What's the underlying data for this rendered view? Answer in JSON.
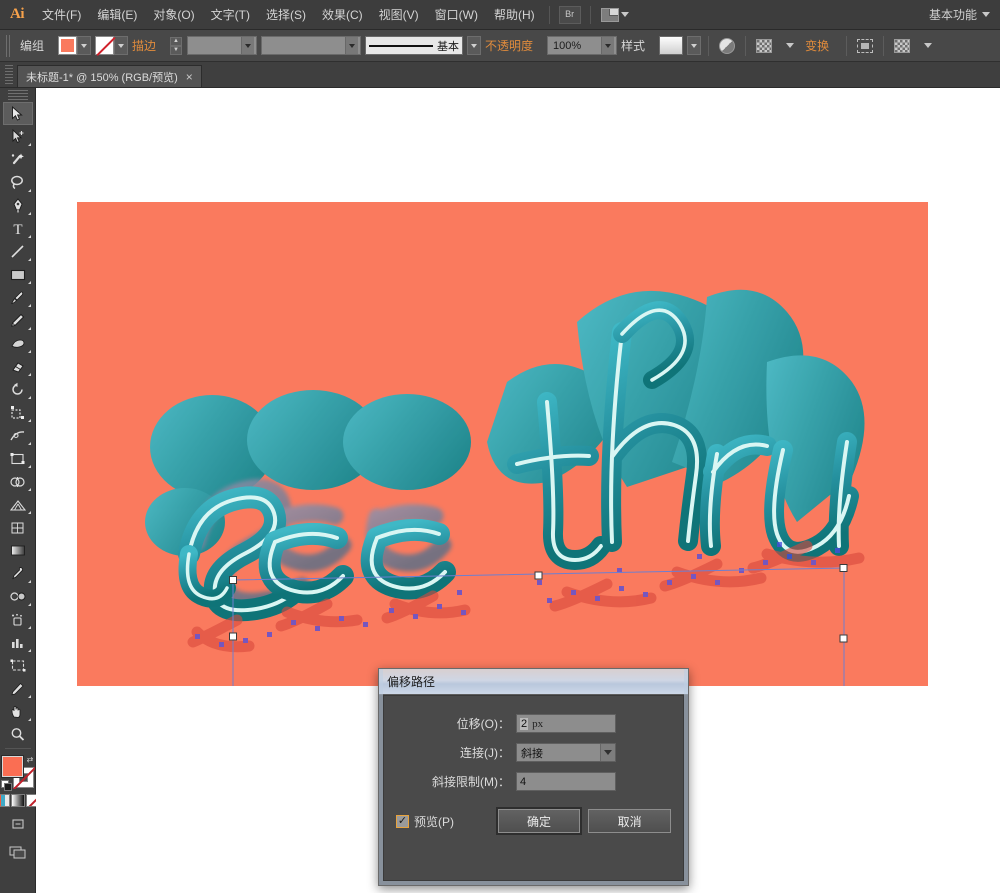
{
  "app": {
    "logo": "Ai",
    "workspace": "基本功能"
  },
  "menu": {
    "items": [
      {
        "label": "文件(F)"
      },
      {
        "label": "编辑(E)"
      },
      {
        "label": "对象(O)"
      },
      {
        "label": "文字(T)"
      },
      {
        "label": "选择(S)"
      },
      {
        "label": "效果(C)"
      },
      {
        "label": "视图(V)"
      },
      {
        "label": "窗口(W)"
      },
      {
        "label": "帮助(H)"
      }
    ],
    "bridge_icon": "bridge-icon",
    "arrange_icon": "arrange-documents-icon"
  },
  "controlbar": {
    "selection_label": "编组",
    "fill_color": "#fa7a5e",
    "stroke_label": "描边",
    "stroke_weight": "",
    "stroke_profile": "",
    "brush_label": "基本",
    "opacity_label": "不透明度",
    "opacity_value": "100%",
    "style_label": "样式",
    "transform_label": "变换",
    "icons": [
      "opacity-circle-icon",
      "recolor-icon",
      "align-icon",
      "shape-options-icon"
    ]
  },
  "document": {
    "tab_title": "未标题-1* @ 150% (RGB/预览)",
    "close_label": "×"
  },
  "toolbar": {
    "tools": [
      {
        "name": "selection-tool",
        "active": true
      },
      {
        "name": "direct-selection-tool",
        "active": false
      },
      {
        "name": "magic-wand-tool",
        "active": false
      },
      {
        "name": "lasso-tool",
        "active": false
      },
      {
        "name": "pen-tool",
        "active": false
      },
      {
        "name": "type-tool",
        "active": false
      },
      {
        "name": "line-segment-tool",
        "active": false
      },
      {
        "name": "rectangle-tool",
        "active": false
      },
      {
        "name": "paintbrush-tool",
        "active": false
      },
      {
        "name": "pencil-tool",
        "active": false
      },
      {
        "name": "blob-brush-tool",
        "active": false
      },
      {
        "name": "eraser-tool",
        "active": false
      },
      {
        "name": "rotate-tool",
        "active": false
      },
      {
        "name": "scale-tool",
        "active": false
      },
      {
        "name": "width-tool",
        "active": false
      },
      {
        "name": "free-transform-tool",
        "active": false
      },
      {
        "name": "shape-builder-tool",
        "active": false
      },
      {
        "name": "perspective-grid-tool",
        "active": false
      },
      {
        "name": "mesh-tool",
        "active": false
      },
      {
        "name": "gradient-tool",
        "active": false
      },
      {
        "name": "eyedropper-tool",
        "active": false
      },
      {
        "name": "blend-tool",
        "active": false
      },
      {
        "name": "symbol-sprayer-tool",
        "active": false
      },
      {
        "name": "column-graph-tool",
        "active": false
      },
      {
        "name": "artboard-tool",
        "active": false
      },
      {
        "name": "slice-tool",
        "active": false
      },
      {
        "name": "hand-tool",
        "active": false
      },
      {
        "name": "zoom-tool",
        "active": false
      }
    ],
    "fill_color": "#fa6e53",
    "stroke_color": "none",
    "color_modes": [
      "color-swatch",
      "gradient-swatch",
      "none-swatch"
    ],
    "draw_mode": "draw-normal-icon",
    "screen_mode": "screen-mode-icon"
  },
  "canvas": {
    "artboard_color": "#fa7a5e",
    "artwork_text": "see thru",
    "artwork_style": "3d-extruded-script",
    "artwork_colors": {
      "face_light": "#3fb3c4",
      "face_dark": "#117d82",
      "extrude": "#2a9aa8",
      "outline": "#d8f4f2",
      "shadow": "#6e6e8c"
    },
    "selection": {
      "anchor_color": "#4a4ae0",
      "path_color": "#d8483c",
      "handle_fill": "#ffffff",
      "bbox_stroke": "#6d7fd0"
    }
  },
  "dialog": {
    "title": "偏移路径",
    "fields": [
      {
        "label": "位移(O)：",
        "value": "2",
        "unit": "px",
        "type": "text"
      },
      {
        "label": "连接(J)：",
        "value": "斜接",
        "type": "select"
      },
      {
        "label": "斜接限制(M)：",
        "value": "4",
        "unit": "",
        "type": "text"
      }
    ],
    "preview_label": "预览(P)",
    "preview_checked": true,
    "checkmark": "✓",
    "ok_label": "确定",
    "cancel_label": "取消"
  }
}
